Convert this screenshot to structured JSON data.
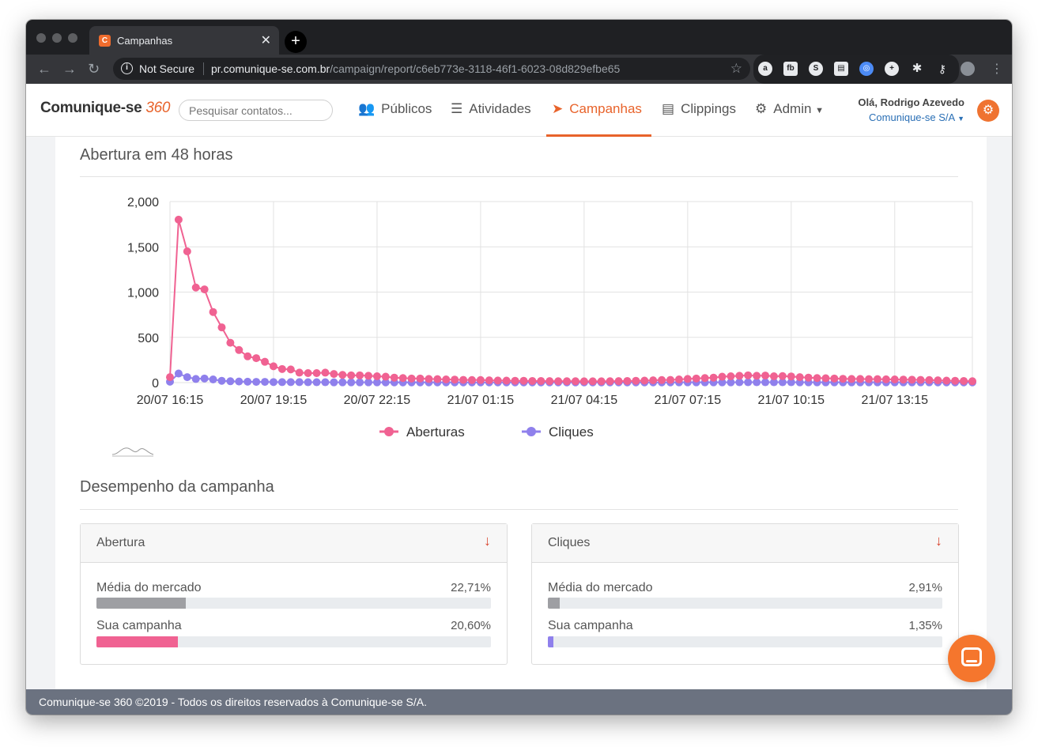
{
  "browser": {
    "tab_title": "Campanhas",
    "not_secure": "Not Secure",
    "url_host": "pr.comunique-se.com.br",
    "url_path": "/campaign/report/c6eb773e-3118-46f1-6023-08d829efbe65"
  },
  "header": {
    "logo_text": "Comunique-se",
    "logo_number": "360",
    "search_placeholder": "Pesquisar contatos...",
    "nav": {
      "publicos": "Públicos",
      "atividades": "Atividades",
      "campanhas": "Campanhas",
      "clippings": "Clippings",
      "admin": "Admin"
    },
    "greeting": "Olá, Rodrigo Azevedo",
    "company": "Comunique-se S/A"
  },
  "chart_section": {
    "title": "Abertura em 48 horas"
  },
  "chart_data": {
    "type": "line",
    "x_tick_labels": [
      "20/07 16:15",
      "20/07 19:15",
      "20/07 22:15",
      "21/07 01:15",
      "21/07 04:15",
      "21/07 07:15",
      "21/07 10:15",
      "21/07 13:15"
    ],
    "y_tick_labels": [
      "0",
      "500",
      "1,000",
      "1,500",
      "2,000"
    ],
    "ylim": [
      0,
      2000
    ],
    "interval_minutes": 15,
    "grid": true,
    "legend_position": "bottom",
    "series": [
      {
        "name": "Aberturas",
        "color": "#f06292",
        "values": [
          60,
          1800,
          1450,
          1050,
          1030,
          780,
          610,
          440,
          360,
          290,
          270,
          230,
          180,
          150,
          145,
          110,
          105,
          105,
          110,
          95,
          85,
          80,
          80,
          75,
          70,
          65,
          55,
          50,
          45,
          45,
          40,
          38,
          35,
          33,
          30,
          28,
          28,
          25,
          23,
          22,
          20,
          20,
          18,
          18,
          16,
          15,
          15,
          15,
          14,
          14,
          14,
          15,
          16,
          18,
          20,
          22,
          25,
          28,
          30,
          35,
          40,
          45,
          50,
          55,
          65,
          70,
          75,
          80,
          75,
          78,
          70,
          72,
          68,
          60,
          55,
          50,
          48,
          45,
          42,
          40,
          40,
          38,
          38,
          36,
          35,
          33,
          32,
          30,
          28,
          25,
          22,
          20,
          18,
          15
        ]
      },
      {
        "name": "Cliques",
        "color": "#8f80ec",
        "values": [
          10,
          100,
          60,
          40,
          45,
          35,
          20,
          15,
          12,
          10,
          8,
          8,
          6,
          5,
          5,
          5,
          4,
          4,
          4,
          3,
          3,
          3,
          3,
          3,
          3,
          2,
          2,
          2,
          2,
          2,
          2,
          2,
          2,
          2,
          2,
          2,
          2,
          2,
          2,
          2,
          2,
          2,
          2,
          2,
          2,
          2,
          2,
          2,
          2,
          2,
          2,
          2,
          2,
          2,
          2,
          2,
          2,
          2,
          2,
          3,
          3,
          3,
          3,
          3,
          3,
          3,
          4,
          4,
          4,
          4,
          4,
          4,
          4,
          3,
          3,
          3,
          3,
          3,
          3,
          3,
          3,
          3,
          3,
          3,
          3,
          3,
          3,
          3,
          3,
          2,
          2,
          2,
          2,
          2
        ]
      }
    ]
  },
  "performance": {
    "title": "Desempenho da campanha",
    "panels": [
      {
        "title": "Abertura",
        "market_label": "Média do mercado",
        "market_value": "22,71%",
        "market_fraction": 0.2271,
        "campaign_label": "Sua campanha",
        "campaign_value": "20,60%",
        "campaign_fraction": 0.206,
        "campaign_color": "#f06292"
      },
      {
        "title": "Cliques",
        "market_label": "Média do mercado",
        "market_value": "2,91%",
        "market_fraction": 0.0291,
        "campaign_label": "Sua campanha",
        "campaign_value": "1,35%",
        "campaign_fraction": 0.0135,
        "campaign_color": "#8f80ec"
      }
    ],
    "market_color": "#9e9fa3"
  },
  "footer": {
    "text": "Comunique-se 360 ©2019 - Todos os direitos reservados à Comunique-se S/A."
  }
}
